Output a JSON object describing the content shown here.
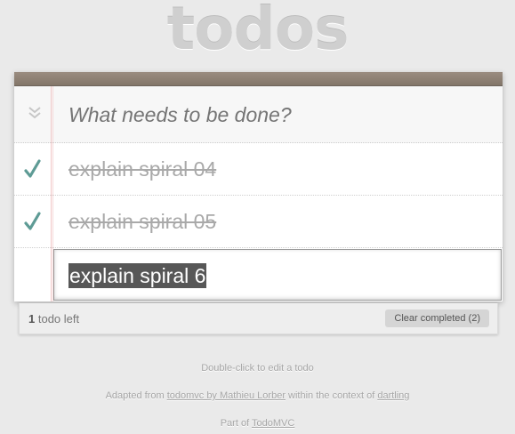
{
  "header": {
    "title": "todos"
  },
  "new_todo": {
    "placeholder": "What needs to be done?"
  },
  "todos": [
    {
      "title": "explain spiral 04",
      "completed": true
    },
    {
      "title": "explain spiral 05",
      "completed": true
    }
  ],
  "editing": {
    "value": "explain spiral 6"
  },
  "footer": {
    "count": "1",
    "count_suffix": "todo left",
    "clear_label": "Clear completed (2)"
  },
  "info": {
    "hint": "Double-click to edit a todo",
    "adapted_prefix": "Adapted from",
    "adapted_link": "todomvc by Mathieu Lorber",
    "adapted_middle": "within the context of",
    "dartling_link": "dartling",
    "part_prefix": "Part of",
    "part_link": "TodoMVC"
  },
  "colors": {
    "check": "#5e9b95",
    "topbar": "#8d8075",
    "selection": "#575757"
  },
  "icons": {
    "toggle_all": "chevron-double-down-icon",
    "check": "checkmark-icon"
  }
}
